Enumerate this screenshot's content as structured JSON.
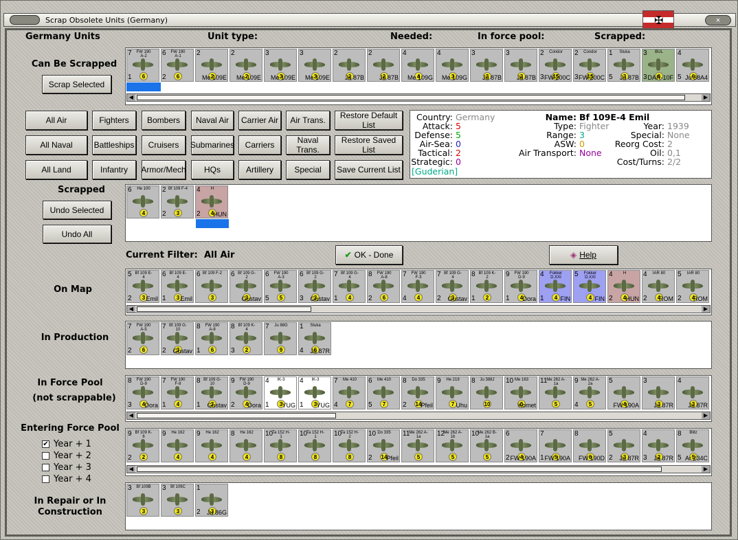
{
  "window": {
    "title": "Scrap Obsolete Units (Germany)",
    "close": "×"
  },
  "header": {
    "units": "Germany Units",
    "unit_type": "Unit type:",
    "needed": "Needed:",
    "force_pool": "In force pool:",
    "scrapped": "Scrapped:"
  },
  "sections": {
    "can_be_scrapped": "Can Be Scrapped",
    "scrapped": "Scrapped",
    "on_map": "On Map",
    "in_production": "In Production",
    "in_force_pool": "In Force Pool",
    "not_scrappable": "(not scrappable)",
    "entering": "Entering Force Pool",
    "repair": "In Repair or In Construction"
  },
  "buttons": {
    "scrap_selected": "Scrap Selected",
    "undo_selected": "Undo Selected",
    "undo_all": "Undo All",
    "ok": "OK - Done",
    "help": "Help",
    "row1": [
      "All Air",
      "Fighters",
      "Bombers",
      "Naval Air",
      "Carrier Air",
      "Air Trans.",
      "Restore Default List"
    ],
    "row2": [
      "All Naval",
      "Battleships",
      "Cruisers",
      "Submarines",
      "Carriers",
      "Naval Trans.",
      "Restore Saved List"
    ],
    "row3": [
      "All Land",
      "Infantry",
      "Armor/Mech",
      "HQs",
      "Artillery",
      "Special",
      "Save Current List"
    ]
  },
  "filter": {
    "label": "Current Filter:",
    "value": "All Air"
  },
  "years": [
    {
      "label": "Year + 1",
      "checked": true
    },
    {
      "label": "Year + 2",
      "checked": false
    },
    {
      "label": "Year + 3",
      "checked": false
    },
    {
      "label": "Year + 4",
      "checked": false
    }
  ],
  "info": {
    "country_l": "Country:",
    "country": "Germany",
    "attack_l": "Attack:",
    "attack": "5",
    "defense_l": "Defense:",
    "defense": "5",
    "airsea_l": "Air-Sea:",
    "airsea": "0",
    "tactical_l": "Tactical:",
    "tactical": "2",
    "strategic_l": "Strategic:",
    "strategic": "0",
    "leader": "[Guderian]",
    "name_l": "Name:",
    "name": "Bf 109E-4 Emil",
    "type_l": "Type:",
    "type": "Fighter",
    "range_l": "Range:",
    "range": "3",
    "asw_l": "ASW:",
    "asw": "0",
    "airtrans_l": "Air Transport:",
    "airtrans": "None",
    "year_l": "Year:",
    "year": "1939",
    "special_l": "Special:",
    "special": "None",
    "reorg_l": "Reorg Cost:",
    "reorg": "2",
    "oil_l": "Oil:",
    "oil": "0,1",
    "cost_l": "Cost/Turns:",
    "cost": "2/2"
  },
  "rows": {
    "can": [
      [
        "7",
        "FW 190 A-2",
        "1",
        "6",
        ""
      ],
      [
        "6",
        "FW 190 A-1",
        "2",
        "6",
        ""
      ],
      [
        "2",
        "",
        "",
        "2",
        "Me 109E"
      ],
      [
        "2",
        "",
        "",
        "2",
        "Me 109E"
      ],
      [
        "3",
        "",
        "",
        "3",
        "Me 109E"
      ],
      [
        "3",
        "",
        "",
        "3",
        "Me 109E"
      ],
      [
        "2",
        "",
        "",
        "2",
        "Ju 87B"
      ],
      [
        "2",
        "",
        "",
        "2",
        "Ju 87B"
      ],
      [
        "4",
        "",
        "",
        "4",
        "Me 109G"
      ],
      [
        "4",
        "",
        "",
        "3",
        "Me 109G"
      ],
      [
        "3",
        "",
        "",
        "3",
        "Ju 87B"
      ],
      [
        "3",
        "",
        "",
        "2",
        "Ju 87B"
      ],
      [
        "2",
        "Condor",
        "3",
        "15",
        "FW 200C"
      ],
      [
        "2",
        "Condor",
        "3",
        "15",
        "FW 200C"
      ],
      [
        "1",
        "Stuka",
        "5",
        "3",
        "Ju 87B"
      ],
      [
        "3",
        "BUL",
        "3",
        "6",
        "DAR-10F"
      ],
      [
        "4",
        "",
        "5",
        "6",
        "Ju 88A4"
      ]
    ],
    "scrapped": [
      [
        "6",
        "He 100",
        "",
        "4",
        ""
      ],
      [
        "2",
        "Bf 109 F-4",
        "2",
        "3",
        ""
      ],
      [
        "4",
        "H",
        "2",
        "4",
        "HUN"
      ]
    ],
    "onmap": [
      [
        "5",
        "Bf 109 E-4",
        "2",
        "3",
        "Emil"
      ],
      [
        "6",
        "Bf 109 E-4",
        "1",
        "3",
        "Emil"
      ],
      [
        "6",
        "Bf 109 F-2",
        "",
        "3",
        ""
      ],
      [
        "6",
        "Bf 109 G-2",
        "",
        "3",
        "Gustav"
      ],
      [
        "6",
        "FW 190 A-3",
        "5",
        "5",
        ""
      ],
      [
        "6",
        "Bf 109 G-2",
        "3",
        "3",
        "Gustav"
      ],
      [
        "7",
        "Bf 109 G-4",
        "1",
        "4",
        ""
      ],
      [
        "8",
        "FW 190 A-8",
        "2",
        "6",
        ""
      ],
      [
        "7",
        "FW 190 F-3",
        "4",
        "4",
        ""
      ],
      [
        "7",
        "Bf 109 G-4",
        "2",
        "3",
        "Gustav"
      ],
      [
        "8",
        "Bf 109 K-2",
        "1",
        "2",
        ""
      ],
      [
        "9",
        "FW 190 D-9",
        "1",
        "4",
        "Dora"
      ],
      [
        "4",
        "Fokker D.XXI",
        "1",
        "4",
        "FIN"
      ],
      [
        "5",
        "Fokker D.XXI",
        "",
        "4",
        "FIN"
      ],
      [
        "4",
        "H",
        "2",
        "4",
        "HUN"
      ],
      [
        "4",
        "IAR 80",
        "2",
        "4",
        "ROM"
      ],
      [
        "5",
        "IAR 80",
        "2",
        "4",
        "ROM"
      ]
    ],
    "prod": [
      [
        "7",
        "FW 190 A-5",
        "2",
        "6",
        ""
      ],
      [
        "7",
        "Bf 109 G-10",
        "2",
        "3",
        "Gustav"
      ],
      [
        "8",
        "FW 190 A-8",
        "1",
        "6",
        ""
      ],
      [
        "8",
        "Bf 109 K-4",
        "3",
        "2",
        ""
      ],
      [
        "7",
        "Ju 88G",
        "",
        "9",
        ""
      ],
      [
        "1",
        "Stuka",
        "4",
        "6",
        "Ju 87R"
      ]
    ],
    "pool": [
      [
        "8",
        "FW 190 D-9",
        "3",
        "4",
        "Dora"
      ],
      [
        "7",
        "FW 190 F-8",
        "1",
        "4",
        ""
      ],
      [
        "8",
        "Bf 109 G-10",
        "1",
        "3",
        "Gustav"
      ],
      [
        "9",
        "FW 190 D-9",
        "2",
        "4",
        "Dora"
      ],
      [
        "4",
        "IK-3",
        "1",
        "3",
        "YUG"
      ],
      [
        "4",
        "IK-3",
        "1",
        "3",
        "YUG"
      ],
      [
        "7",
        "Me 410",
        "4",
        "7",
        ""
      ],
      [
        "6",
        "Me 410",
        "5",
        "7",
        ""
      ],
      [
        "8",
        "Do 335",
        "2",
        "14",
        "Pfeil"
      ],
      [
        "9",
        "He 219",
        "",
        "7",
        "Uhu"
      ],
      [
        "8",
        "Ju 388J",
        "",
        "10",
        ""
      ],
      [
        "10",
        "Me 163",
        "",
        "0",
        "Komet"
      ],
      [
        "11",
        "Me 262 A-1a",
        "",
        "5",
        ""
      ],
      [
        "9",
        "Me 262 A-2a",
        "4",
        "5",
        ""
      ],
      [
        "5",
        "",
        "",
        "4",
        "FW 190A"
      ],
      [
        "3",
        "",
        "",
        "3",
        "Ju 87R"
      ],
      [
        "4",
        "",
        "",
        "3",
        "Ju 87R"
      ]
    ],
    "enter": [
      [
        "9",
        "Bf 109 K-6",
        "2",
        "2",
        ""
      ],
      [
        "9",
        "He 162",
        "",
        "4",
        ""
      ],
      [
        "9",
        "He 162",
        "",
        "4",
        ""
      ],
      [
        "8",
        "He 162",
        "",
        "4",
        ""
      ],
      [
        "10",
        "Ta 152 H-1",
        "",
        "8",
        ""
      ],
      [
        "10",
        "Ta 152 H-1",
        "",
        "8",
        ""
      ],
      [
        "10",
        "Ta 152 H-2",
        "",
        "8",
        ""
      ],
      [
        "10",
        "Do 335",
        "2",
        "14",
        "Pfeil"
      ],
      [
        "11",
        "Me 262 A-1a",
        "",
        "5",
        ""
      ],
      [
        "12",
        "Me 262 A-1b",
        "",
        "5",
        ""
      ],
      [
        "10",
        "Me 262 B-1a",
        "",
        "5",
        ""
      ],
      [
        "6",
        "",
        "2",
        "4",
        "FW 190A"
      ],
      [
        "7",
        "",
        "1",
        "5",
        "FW 190A"
      ],
      [
        "8",
        "",
        "",
        "6",
        "FW 190D"
      ],
      [
        "5",
        "",
        "2",
        "3",
        "Ju 87R"
      ],
      [
        "4",
        "",
        "3",
        "2",
        "Ju 87R"
      ],
      [
        "8",
        "Blitz",
        "5",
        "5",
        "Ar 234C"
      ]
    ],
    "repair": [
      [
        "3",
        "Bf 109B",
        "",
        "3",
        ""
      ],
      [
        "3",
        "Bf 109C",
        "",
        "3",
        ""
      ],
      [
        "1",
        "",
        "2",
        "3",
        "Ju 86G"
      ]
    ]
  }
}
